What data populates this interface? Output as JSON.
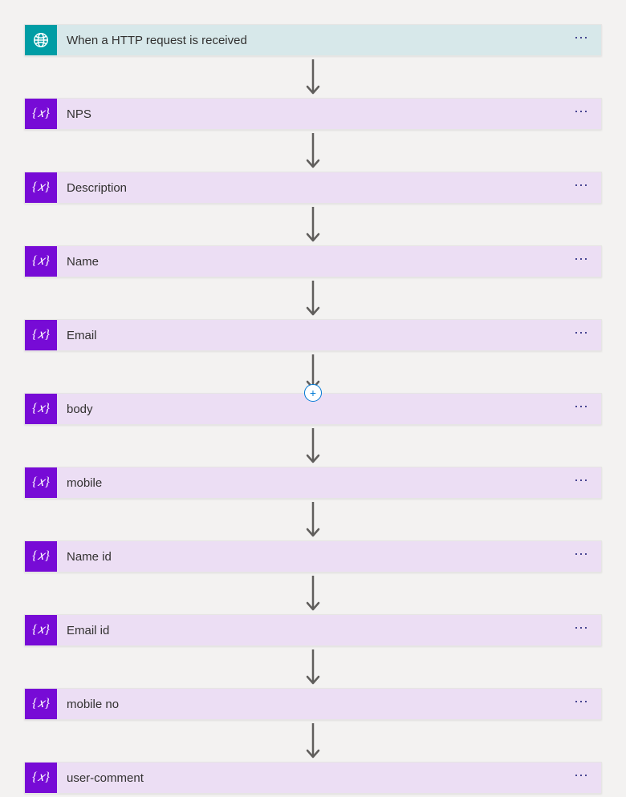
{
  "steps": [
    {
      "label": "When a HTTP request is received",
      "type": "trigger",
      "plus_after": false
    },
    {
      "label": "NPS",
      "type": "variable",
      "plus_after": false
    },
    {
      "label": "Description",
      "type": "variable",
      "plus_after": false
    },
    {
      "label": "Name",
      "type": "variable",
      "plus_after": false
    },
    {
      "label": "Email",
      "type": "variable",
      "plus_after": true
    },
    {
      "label": "body",
      "type": "variable",
      "plus_after": false
    },
    {
      "label": "mobile",
      "type": "variable",
      "plus_after": false
    },
    {
      "label": "Name id",
      "type": "variable",
      "plus_after": false
    },
    {
      "label": "Email id",
      "type": "variable",
      "plus_after": false
    },
    {
      "label": "mobile no",
      "type": "variable",
      "plus_after": false
    },
    {
      "label": "user-comment",
      "type": "variable",
      "plus_after": false
    }
  ],
  "icons": {
    "variable_glyph": "{𝑥}"
  }
}
